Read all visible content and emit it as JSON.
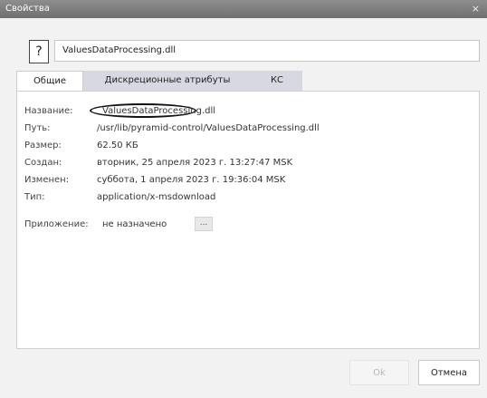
{
  "window": {
    "title": "Свойства",
    "close_glyph": "×"
  },
  "file": {
    "icon_glyph": "?",
    "name": "ValuesDataProcessing.dll"
  },
  "tabs": [
    {
      "label": "Общие",
      "active": true
    },
    {
      "label": "Дискреционные атрибуты",
      "active": false
    },
    {
      "label": "КС",
      "active": false
    }
  ],
  "properties": {
    "name": {
      "label": "Название:",
      "value": "ValuesDataProcessing.dll"
    },
    "path": {
      "label": "Путь:",
      "value": "/usr/lib/pyramid-control/ValuesDataProcessing.dll"
    },
    "size": {
      "label": "Размер:",
      "value": "62.50 КБ"
    },
    "created": {
      "label": "Создан:",
      "value": "вторник, 25 апреля 2023 г. 13:27:47 MSK"
    },
    "modified": {
      "label": "Изменен:",
      "value": "суббота, 1 апреля 2023 г. 19:36:04 MSK"
    },
    "type": {
      "label": "Тип:",
      "value": "application/x-msdownload"
    },
    "application": {
      "label": "Приложение:",
      "value": "не назначено",
      "button_label": "..."
    }
  },
  "buttons": {
    "ok": "Ok",
    "cancel": "Отмена"
  }
}
